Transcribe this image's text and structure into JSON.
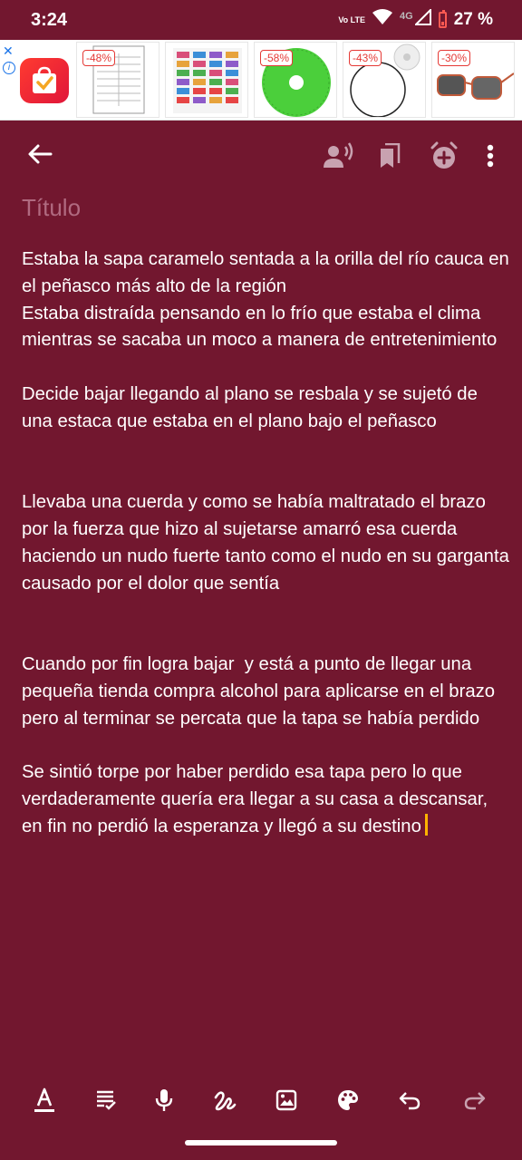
{
  "status_bar": {
    "time": "3:24",
    "volte_label": "Vo LTE",
    "network_label": "4G",
    "battery_text": "27 %"
  },
  "ad": {
    "close_symbol": "✕",
    "info_symbol": "i",
    "products": [
      {
        "discount": "-48%"
      },
      {
        "discount": ""
      },
      {
        "discount": "-58%"
      },
      {
        "discount": "-43%"
      },
      {
        "discount": "-30%"
      }
    ]
  },
  "toolbar": {
    "back_icon": "arrow-back-icon",
    "icons": [
      "voice-icon",
      "bookmark-icon",
      "add-reminder-icon",
      "more-vert-icon"
    ]
  },
  "note": {
    "title_placeholder": "Título",
    "paragraphs": [
      "Estaba la sapa caramelo sentada a la orilla del río cauca en el peñasco más alto de la región\nEstaba distraída pensando en lo frío que estaba el clima mientras se sacaba un moco a manera de entretenimiento",
      "Decide bajar llegando al plano se resbala y se sujetó de una estaca que estaba en el plano bajo el peñasco",
      "Llevaba una cuerda y como se había maltratado el brazo por la fuerza que hizo al sujetarse amarró esa cuerda haciendo un nudo fuerte tanto como el nudo en su garganta causado por el dolor que sentía",
      "Cuando por fin logra bajar  y está a punto de llegar una pequeña tienda compra alcohol para aplicarse en el brazo pero al terminar se percata que la tapa se había perdido",
      "Se sintió torpe por haber perdido esa tapa pero lo que verdaderamente quería era llegar a su casa a descansar, en fin no perdió la esperanza y llegó a su destino"
    ]
  },
  "bottom_bar": {
    "icons": [
      "text-format-icon",
      "checklist-icon",
      "mic-icon",
      "draw-icon",
      "image-icon",
      "palette-icon",
      "undo-icon",
      "redo-icon"
    ]
  },
  "colors": {
    "background": "#72172f",
    "title_placeholder": "#b06a80",
    "cursor": "#ffb300"
  }
}
